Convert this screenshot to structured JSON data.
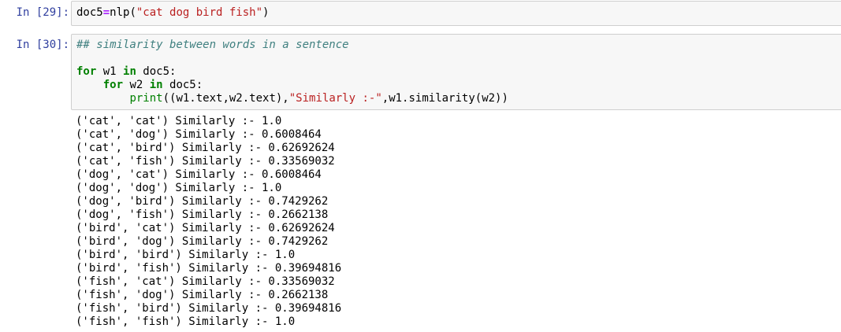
{
  "cell1": {
    "prompt": "In [29]:",
    "code": {
      "var": "doc5",
      "eq": "=",
      "call": "nlp(",
      "string": "\"cat dog bird fish\"",
      "close": ")"
    }
  },
  "cell2": {
    "prompt": "In [30]:",
    "comment": "## similarity between words in a sentence",
    "line_for1": {
      "kw_for": "for",
      "var": " w1 ",
      "kw_in": "in",
      "rest": " doc5:"
    },
    "line_for2": {
      "indent": "    ",
      "kw_for": "for",
      "var": " w2 ",
      "kw_in": "in",
      "rest": " doc5:"
    },
    "line_print": {
      "indent": "        ",
      "builtin": "print",
      "args1": "((w1.text,w2.text),",
      "string": "\"Similarly :-\"",
      "args2": ",w1.similarity(w2))"
    },
    "output": [
      "('cat', 'cat') Similarly :- 1.0",
      "('cat', 'dog') Similarly :- 0.6008464",
      "('cat', 'bird') Similarly :- 0.62692624",
      "('cat', 'fish') Similarly :- 0.33569032",
      "('dog', 'cat') Similarly :- 0.6008464",
      "('dog', 'dog') Similarly :- 1.0",
      "('dog', 'bird') Similarly :- 0.7429262",
      "('dog', 'fish') Similarly :- 0.2662138",
      "('bird', 'cat') Similarly :- 0.62692624",
      "('bird', 'dog') Similarly :- 0.7429262",
      "('bird', 'bird') Similarly :- 1.0",
      "('bird', 'fish') Similarly :- 0.39694816",
      "('fish', 'cat') Similarly :- 0.33569032",
      "('fish', 'dog') Similarly :- 0.2662138",
      "('fish', 'bird') Similarly :- 0.39694816",
      "('fish', 'fish') Similarly :- 1.0"
    ]
  },
  "colors": {
    "prompt": "#303f9f",
    "keyword": "#008000",
    "string": "#ba2121",
    "operator": "#aa22ff",
    "comment": "#408080",
    "input_bg": "#f7f7f7",
    "input_border": "#cfcfcf"
  }
}
